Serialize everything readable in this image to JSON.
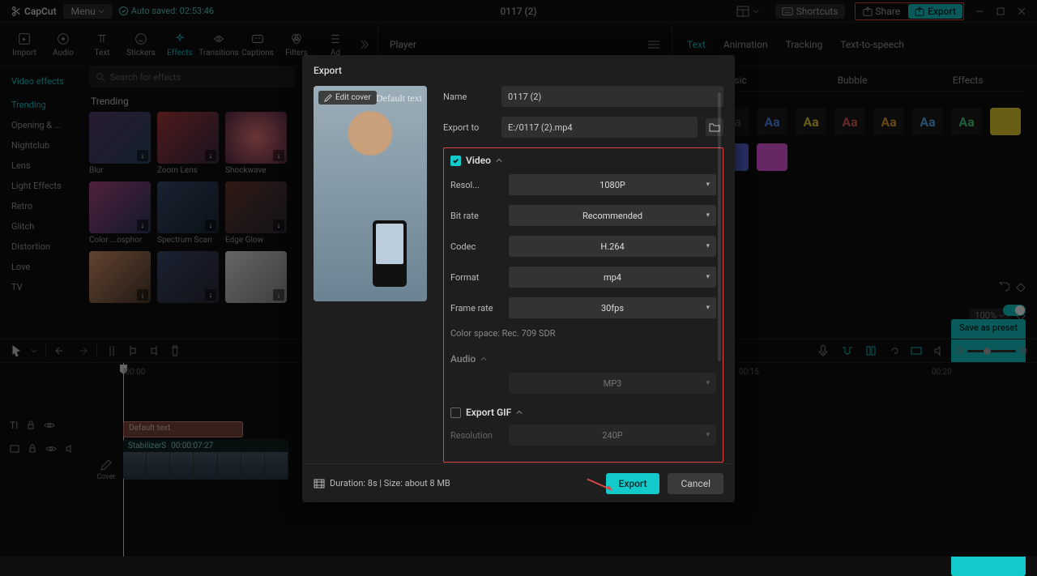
{
  "app_name": "CapCut",
  "menu_label": "Menu",
  "auto_saved_label": "Auto saved: 02:53:46",
  "project_title": "0117 (2)",
  "shortcuts_label": "Shortcuts",
  "share_label": "Share",
  "export_top_label": "Export",
  "tool_tabs": {
    "import": "Import",
    "audio": "Audio",
    "text": "Text",
    "stickers": "Stickers",
    "effects": "Effects",
    "transitions": "Transitions",
    "captions": "Captions",
    "filters": "Filters",
    "adjustment": "Ad"
  },
  "player_label": "Player",
  "right_tabs": {
    "text": "Text",
    "animation": "Animation",
    "tracking": "Tracking",
    "tts": "Text-to-speech"
  },
  "right_sub_tabs": {
    "basic": "...sic",
    "bubble": "Bubble",
    "effects": "Effects"
  },
  "video_effects_label": "Video effects",
  "categories": [
    "Trending",
    "Opening & ...",
    "Nightclub",
    "Lens",
    "Light Effects",
    "Retro",
    "Glitch",
    "Distortion",
    "Love",
    "TV"
  ],
  "search_placeholder": "Search for effects",
  "section_trending": "Trending",
  "thumbs": [
    {
      "label": "Blur"
    },
    {
      "label": "Zoom Lens"
    },
    {
      "label": "Shockwave"
    },
    {
      "label": "Color ...osphor"
    },
    {
      "label": "Spectrum Scan"
    },
    {
      "label": "Edge Glow"
    },
    {
      "label": ""
    },
    {
      "label": ""
    },
    {
      "label": ""
    }
  ],
  "zoom_value": "100%",
  "save_preset_label": "Save as preset",
  "timeline_ticks": [
    "|00:00",
    "00:15",
    "00:20"
  ],
  "text_clip_label": "Default text",
  "video_clip_name": "StabilizerS",
  "video_clip_dur": "00:00:07:27",
  "cover_label": "Cover",
  "modal": {
    "title": "Export",
    "edit_cover": "Edit cover",
    "default_text": "Default text",
    "name_label": "Name",
    "name_value": "0117 (2)",
    "export_to_label": "Export to",
    "export_to_value": "E:/0117 (2).mp4",
    "video_section": "Video",
    "resolution_label": "Resol...",
    "resolution_value": "1080P",
    "bitrate_label": "Bit rate",
    "bitrate_value": "Recommended",
    "codec_label": "Codec",
    "codec_value": "H.264",
    "format_label": "Format",
    "format_value": "mp4",
    "framerate_label": "Frame rate",
    "framerate_value": "30fps",
    "colorspace_label": "Color space: Rec. 709 SDR",
    "audio_section": "Audio",
    "audio_format_value": "MP3",
    "gif_section": "Export GIF",
    "gif_res_label": "Resolution",
    "gif_res_value": "240P",
    "duration_info": "Duration: 8s | Size: about 8 MB",
    "export_btn": "Export",
    "cancel_btn": "Cancel"
  }
}
